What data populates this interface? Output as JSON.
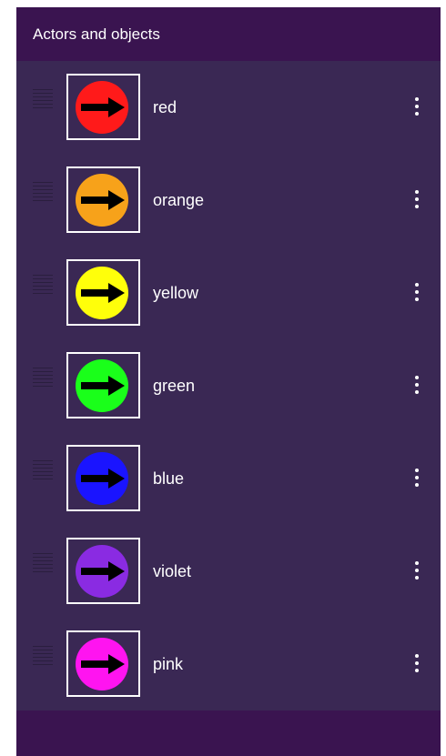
{
  "header": {
    "title": "Actors and objects"
  },
  "actors": [
    {
      "name": "red",
      "color": "#ff1a1a"
    },
    {
      "name": "orange",
      "color": "#f7a21a"
    },
    {
      "name": "yellow",
      "color": "#ffff0a"
    },
    {
      "name": "green",
      "color": "#1aff1a"
    },
    {
      "name": "blue",
      "color": "#1a14ff"
    },
    {
      "name": "violet",
      "color": "#8a2be2"
    },
    {
      "name": "pink",
      "color": "#ff14f0"
    }
  ],
  "icons": {
    "drag": "drag-handle-icon",
    "more": "more-vert-icon",
    "arrow": "right-arrow-icon"
  },
  "colors": {
    "background": "#3a2854",
    "bar": "#3a1450",
    "text": "#ffffff"
  }
}
